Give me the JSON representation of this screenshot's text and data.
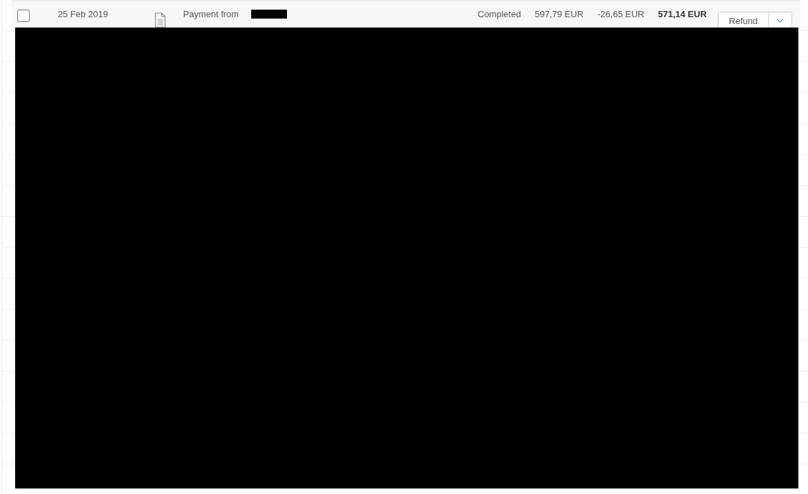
{
  "transactions": [
    {
      "checked": false,
      "date": "25 Feb 2019",
      "description": "Payment from",
      "payee_redacted": true,
      "status": "Completed",
      "gross": "597,79 EUR",
      "fee": "-26,65 EUR",
      "net": "571,14 EUR",
      "action": "Refund"
    }
  ],
  "redaction_overlay": true
}
